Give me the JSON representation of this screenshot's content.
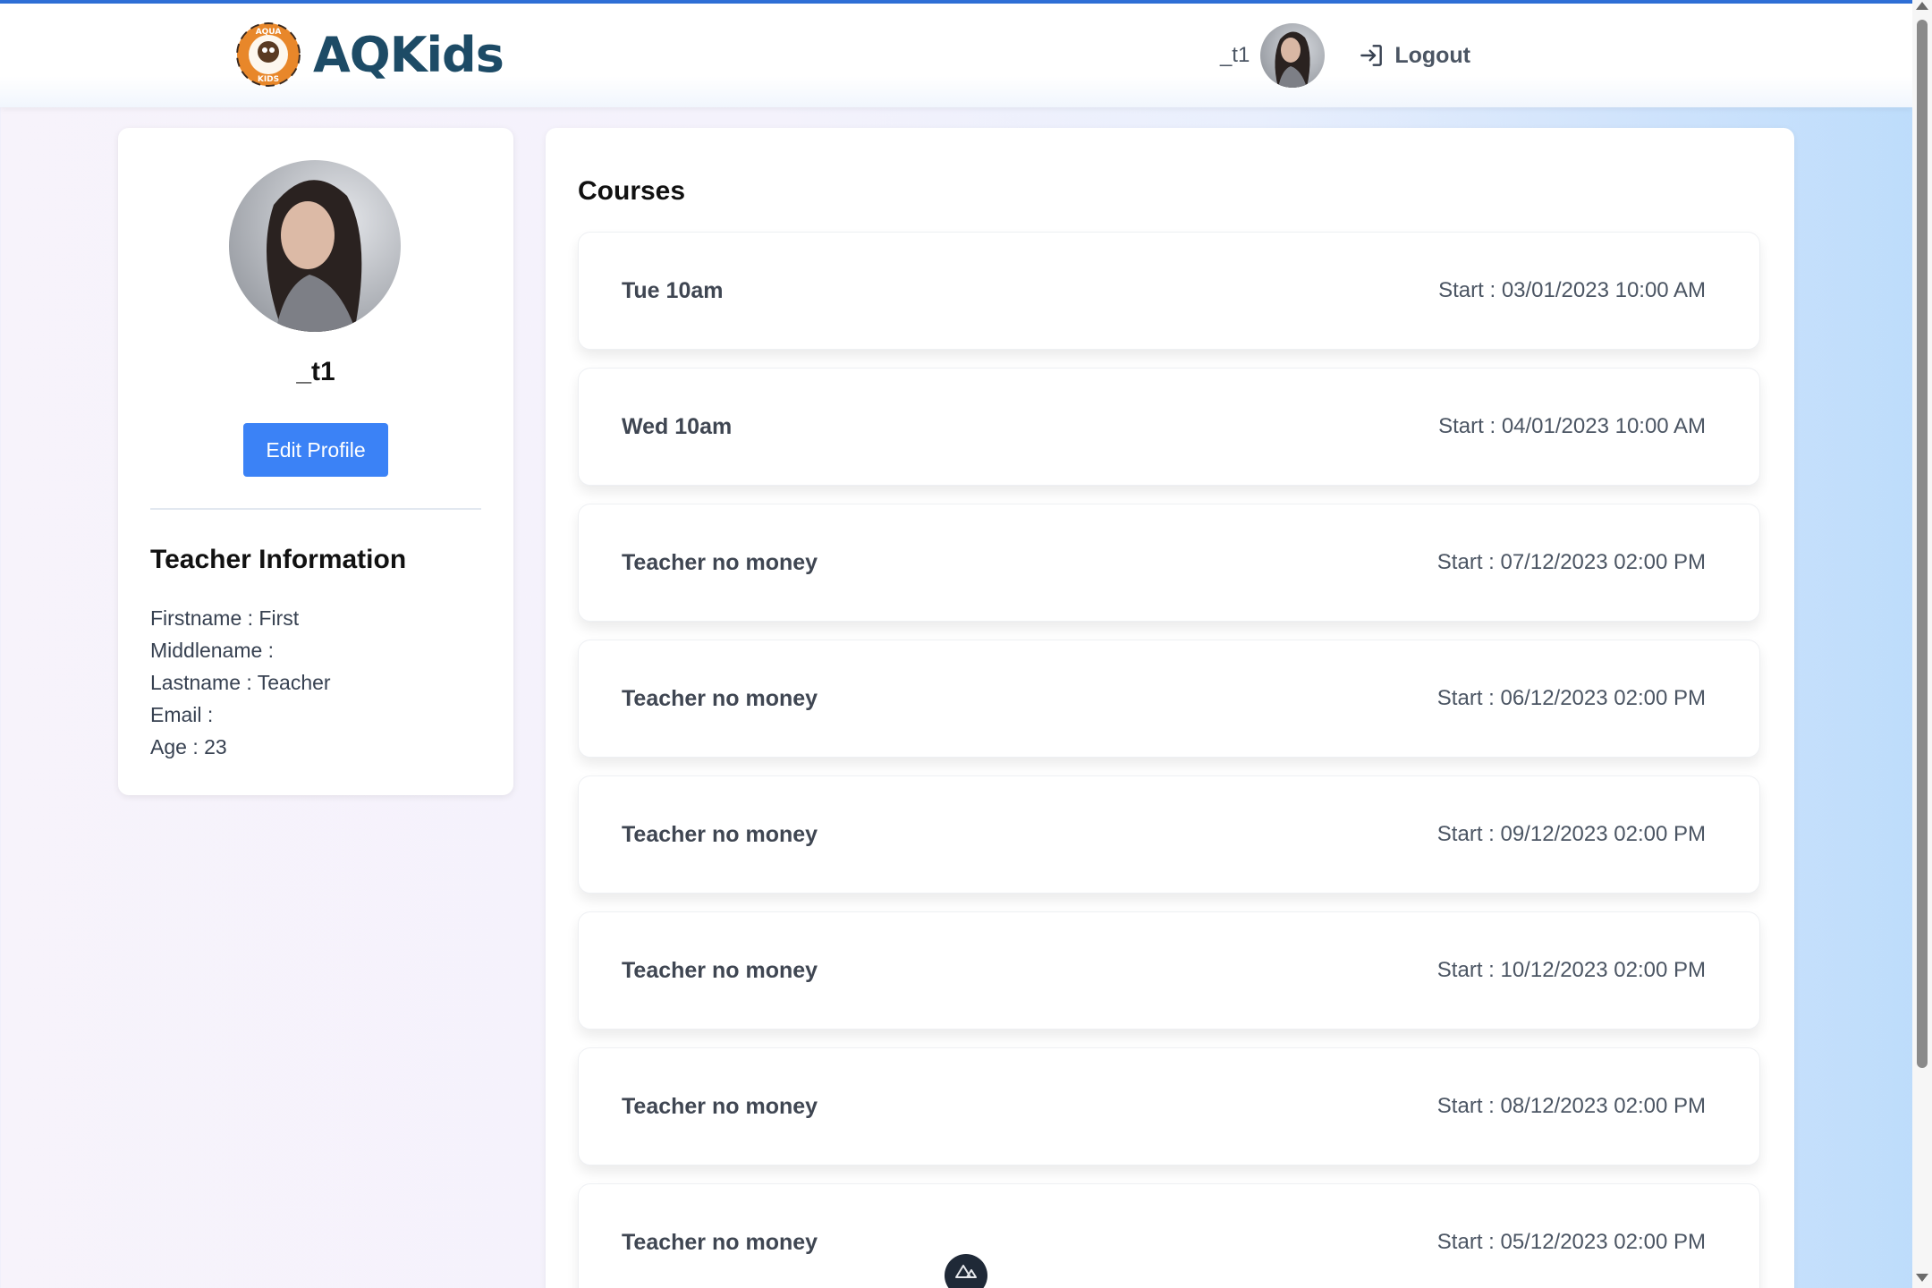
{
  "brand": {
    "name": "AQKids"
  },
  "nav": {
    "username": "_t1",
    "logout_label": "Logout"
  },
  "profile": {
    "name": "_t1",
    "edit_label": "Edit Profile",
    "info_title": "Teacher Information",
    "fields": [
      "Firstname : First",
      "Middlename :",
      "Lastname : Teacher",
      "Email :",
      "Age : 23"
    ]
  },
  "courses": {
    "title": "Courses",
    "items": [
      {
        "name": "Tue 10am",
        "start": "Start : 03/01/2023 10:00 AM"
      },
      {
        "name": "Wed 10am",
        "start": "Start : 04/01/2023 10:00 AM"
      },
      {
        "name": "Teacher no money",
        "start": "Start : 07/12/2023 02:00 PM"
      },
      {
        "name": "Teacher no money",
        "start": "Start : 06/12/2023 02:00 PM"
      },
      {
        "name": "Teacher no money",
        "start": "Start : 09/12/2023 02:00 PM"
      },
      {
        "name": "Teacher no money",
        "start": "Start : 10/12/2023 02:00 PM"
      },
      {
        "name": "Teacher no money",
        "start": "Start : 08/12/2023 02:00 PM"
      },
      {
        "name": "Teacher no money",
        "start": "Start : 05/12/2023 02:00 PM"
      }
    ]
  },
  "colors": {
    "brand_text": "#1d4b66",
    "primary_button": "#3b82f6",
    "top_accent": "#2f6fd6"
  },
  "icons": {
    "logo": "aqkids-logo",
    "logout": "logout-icon",
    "devtools": "nuxt-devtools-icon"
  }
}
